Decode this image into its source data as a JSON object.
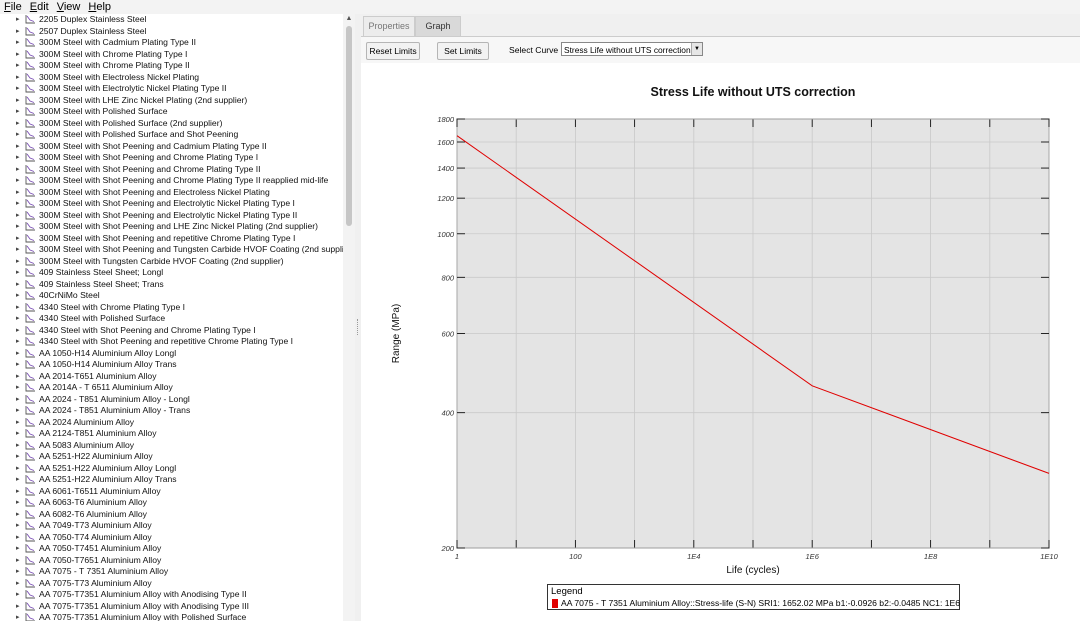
{
  "menu": [
    "File",
    "Edit",
    "View",
    "Help"
  ],
  "tree": {
    "items": [
      "2205 Duplex Stainless Steel",
      "2507 Duplex Stainless Steel",
      "300M Steel with Cadmium Plating Type II",
      "300M Steel with Chrome Plating Type I",
      "300M Steel with Chrome Plating Type II",
      "300M Steel with Electroless Nickel Plating",
      "300M Steel with Electrolytic Nickel Plating Type II",
      "300M Steel with LHE Zinc Nickel Plating (2nd supplier)",
      "300M Steel with Polished Surface",
      "300M Steel with Polished Surface (2nd supplier)",
      "300M Steel with Polished Surface and Shot Peening",
      "300M Steel with Shot Peening and Cadmium Plating Type II",
      "300M Steel with Shot Peening and Chrome Plating Type I",
      "300M Steel with Shot Peening and Chrome Plating Type II",
      "300M Steel with Shot Peening and Chrome Plating Type II reapplied mid-life",
      "300M Steel with Shot Peening and Electroless Nickel Plating",
      "300M Steel with Shot Peening and Electrolytic Nickel Plating Type I",
      "300M Steel with Shot Peening and Electrolytic Nickel Plating Type II",
      "300M Steel with Shot Peening and LHE Zinc Nickel Plating (2nd supplier)",
      "300M Steel with Shot Peening and repetitive Chrome Plating Type I",
      "300M Steel with Shot Peening and Tungsten Carbide HVOF Coating (2nd suppli...",
      "300M Steel with Tungsten Carbide HVOF Coating (2nd supplier)",
      "409 Stainless Steel Sheet; Longl",
      "409 Stainless Steel Sheet; Trans",
      "40CrNiMo Steel",
      "4340 Steel with Chrome Plating Type I",
      "4340 Steel with Polished Surface",
      "4340 Steel with Shot Peening and Chrome Plating Type I",
      "4340 Steel with Shot Peening and repetitive Chrome Plating Type I",
      "AA 1050-H14 Aluminium Alloy Longl",
      "AA 1050-H14 Aluminium Alloy Trans",
      "AA 2014-T651 Aluminium Alloy",
      "AA 2014A - T 6511 Aluminium Alloy",
      "AA 2024 - T851 Aluminium Alloy - Longl",
      "AA 2024 - T851 Aluminium Alloy - Trans",
      "AA 2024 Aluminium Alloy",
      "AA 2124-T851 Aluminium Alloy",
      "AA 5083 Aluminium Alloy",
      "AA 5251-H22 Aluminium Alloy",
      "AA 5251-H22 Aluminium Alloy Longl",
      "AA 5251-H22 Aluminium Alloy Trans",
      "AA 6061-T6511 Aluminium Alloy",
      "AA 6063-T6 Aluminium Alloy",
      "AA 6082-T6 Aluminium Alloy",
      "AA 7049-T73 Aluminium Alloy",
      "AA 7050-T74 Aluminium Alloy",
      "AA 7050-T7451 Aluminium Alloy",
      "AA 7050-T7651 Aluminium Alloy",
      "AA 7075 - T 7351 Aluminium Alloy",
      "AA 7075-T73 Aluminium Alloy",
      "AA 7075-T7351 Aluminium Alloy with Anodising Type II",
      "AA 7075-T7351 Aluminium Alloy with Anodising Type III",
      "AA 7075-T7351 Aluminium Alloy with Polished Surface"
    ]
  },
  "tabs": {
    "properties": "Properties",
    "graph": "Graph"
  },
  "toolbar": {
    "reset_label": "Reset Limits",
    "set_label": "Set Limits",
    "select_label": "Select Curve",
    "select_value": "Stress Life without UTS correction"
  },
  "legend": {
    "title": "Legend",
    "entry": "AA 7075 - T 7351 Aluminium Alloy::Stress-life (S-N) SRI1: 1652.02 MPa  b1:-0.0926 b2:-0.0485 NC1: 1E6",
    "color": "#e00000"
  },
  "chart_data": {
    "type": "line",
    "title": "Stress Life without UTS correction",
    "xlabel": "Life (cycles)",
    "ylabel": "Range (MPa)",
    "x_scale": "log",
    "y_scale": "log",
    "xlim": [
      1,
      10000000000
    ],
    "ylim": [
      200,
      1800
    ],
    "x_ticks": [
      1,
      100,
      10000,
      1000000,
      100000000,
      10000000000
    ],
    "x_tick_labels": [
      "1",
      "100",
      "1E4",
      "1E6",
      "1E8",
      "1E10"
    ],
    "y_ticks": [
      200,
      400,
      600,
      800,
      1000,
      1200,
      1400,
      1600,
      1800
    ],
    "y_tick_labels": [
      "200",
      "400",
      "600",
      "800",
      "1000",
      "1200",
      "1400",
      "1600",
      "1800"
    ],
    "grid": true,
    "series": [
      {
        "name": "AA 7075 - T 7351 Aluminium Alloy::Stress-life (S-N)",
        "color": "#e00000",
        "x": [
          1,
          1000000,
          10000000000
        ],
        "y": [
          1652.02,
          459,
          293
        ]
      }
    ]
  }
}
